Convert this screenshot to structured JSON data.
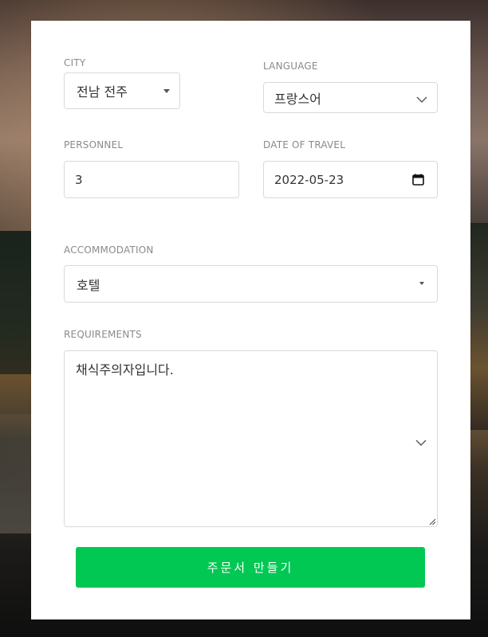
{
  "form": {
    "city": {
      "label": "CITY",
      "value": "전남 전주",
      "icon": "caret-down-icon"
    },
    "language": {
      "label": "LANGUAGE",
      "value": "프랑스어",
      "icon": "chevron-down-icon"
    },
    "personnel": {
      "label": "PERSONNEL",
      "value": "3"
    },
    "date_of_travel": {
      "label": "DATE OF TRAVEL",
      "value": "2022-05-23",
      "icon": "calendar-icon"
    },
    "accommodation": {
      "label": "ACCOMMODATION",
      "value": "호텔",
      "icon": "caret-down-icon"
    },
    "requirements": {
      "label": "REQUIREMENTS",
      "value": "채식주의자입니다.",
      "icon": "chevron-down-icon"
    },
    "submit_label": "주문서 만들기"
  },
  "colors": {
    "accent": "#00c853",
    "label": "#8a8a8a",
    "border": "#d9d9d9"
  }
}
